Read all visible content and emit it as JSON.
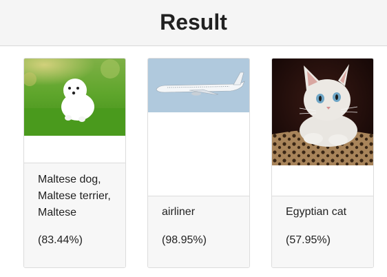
{
  "header": {
    "title": "Result"
  },
  "results": [
    {
      "image": "white-puppy-on-grass-image",
      "label": "Maltese dog, Maltese terrier, Maltese",
      "score": "(83.44%)"
    },
    {
      "image": "airliner-in-sky-image",
      "label": "airliner",
      "score": "(98.95%)"
    },
    {
      "image": "kitten-photo-image",
      "label": "Egyptian cat",
      "score": "(57.95%)"
    }
  ],
  "colors": {
    "header_bg": "#f5f5f5",
    "card_border": "#dcdcdc",
    "footer_bg": "#f7f7f7",
    "text": "#212121",
    "sky": "#b0c9dd"
  }
}
